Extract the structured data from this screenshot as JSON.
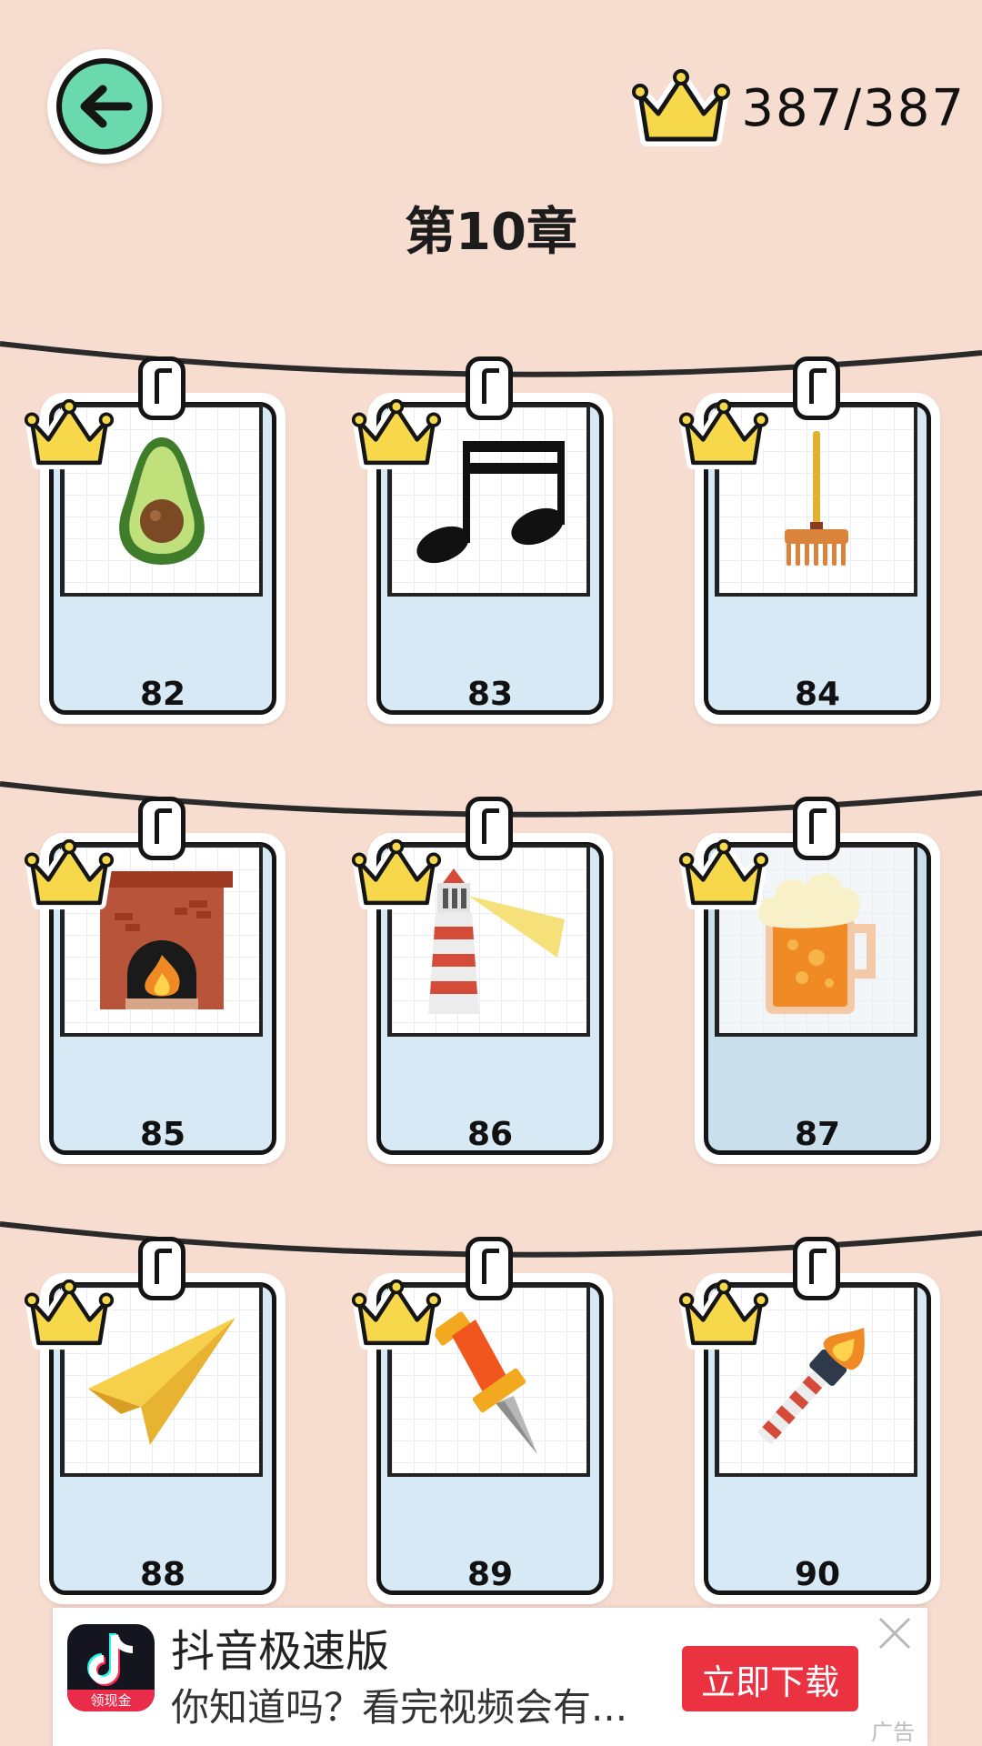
{
  "header": {
    "back_icon": "arrow-left-icon",
    "score_icon": "crown-icon",
    "score_text": "387/387",
    "chapter_title": "第10章"
  },
  "levels": [
    {
      "number": "82",
      "icon": "avocado-icon",
      "completed": true
    },
    {
      "number": "83",
      "icon": "music-notes-icon",
      "completed": true
    },
    {
      "number": "84",
      "icon": "rake-icon",
      "completed": true
    },
    {
      "number": "85",
      "icon": "fireplace-icon",
      "completed": true
    },
    {
      "number": "86",
      "icon": "lighthouse-icon",
      "completed": true
    },
    {
      "number": "87",
      "icon": "beer-mug-icon",
      "completed": true
    },
    {
      "number": "88",
      "icon": "paper-plane-icon",
      "completed": true
    },
    {
      "number": "89",
      "icon": "pushpin-icon",
      "completed": true
    },
    {
      "number": "90",
      "icon": "torch-icon",
      "completed": true
    }
  ],
  "ad": {
    "app_name": "抖音极速版",
    "app_badge": "领现金",
    "description": "你知道吗？看完视频会有...",
    "cta_label": "立即下载",
    "ad_label": "广告"
  },
  "colors": {
    "background": "#f7dcd0",
    "back_button": "#6ad9ad",
    "crown": "#f6d84a",
    "card": "#d6e9f5",
    "cta": "#ea3240"
  }
}
